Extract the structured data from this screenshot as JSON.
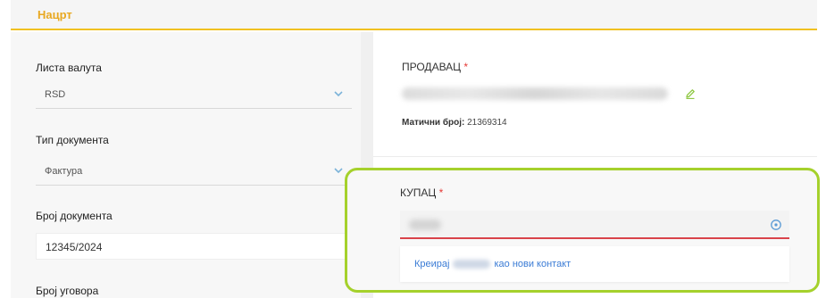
{
  "header": {
    "title": "Нацрт"
  },
  "left": {
    "currency_list": {
      "label": "Листа валута",
      "value": "RSD"
    },
    "document_type": {
      "label": "Тип документа",
      "value": "Фактура"
    },
    "document_number": {
      "label": "Број документа",
      "value": "12345/2024"
    },
    "contract_number": {
      "label": "Број уговора"
    }
  },
  "seller": {
    "label": "ПРОДАВАЦ",
    "required_mark": "*",
    "registration_label": "Матични број:",
    "registration_value": "21369314"
  },
  "buyer": {
    "label": "КУПАЦ",
    "required_mark": "*",
    "suggestion_prefix": "Креирај",
    "suggestion_suffix": "као нови контакт"
  },
  "colors": {
    "accent": "#f0c020",
    "title": "#e8a820",
    "highlight": "#a5d12c",
    "error_underline": "#d9434a",
    "link": "#3a7bd5",
    "icon": "#7bb3d9"
  },
  "icons": {
    "select_arrow": "chevron-down-icon",
    "edit": "pencil-icon",
    "clear": "circle-clear-icon"
  }
}
